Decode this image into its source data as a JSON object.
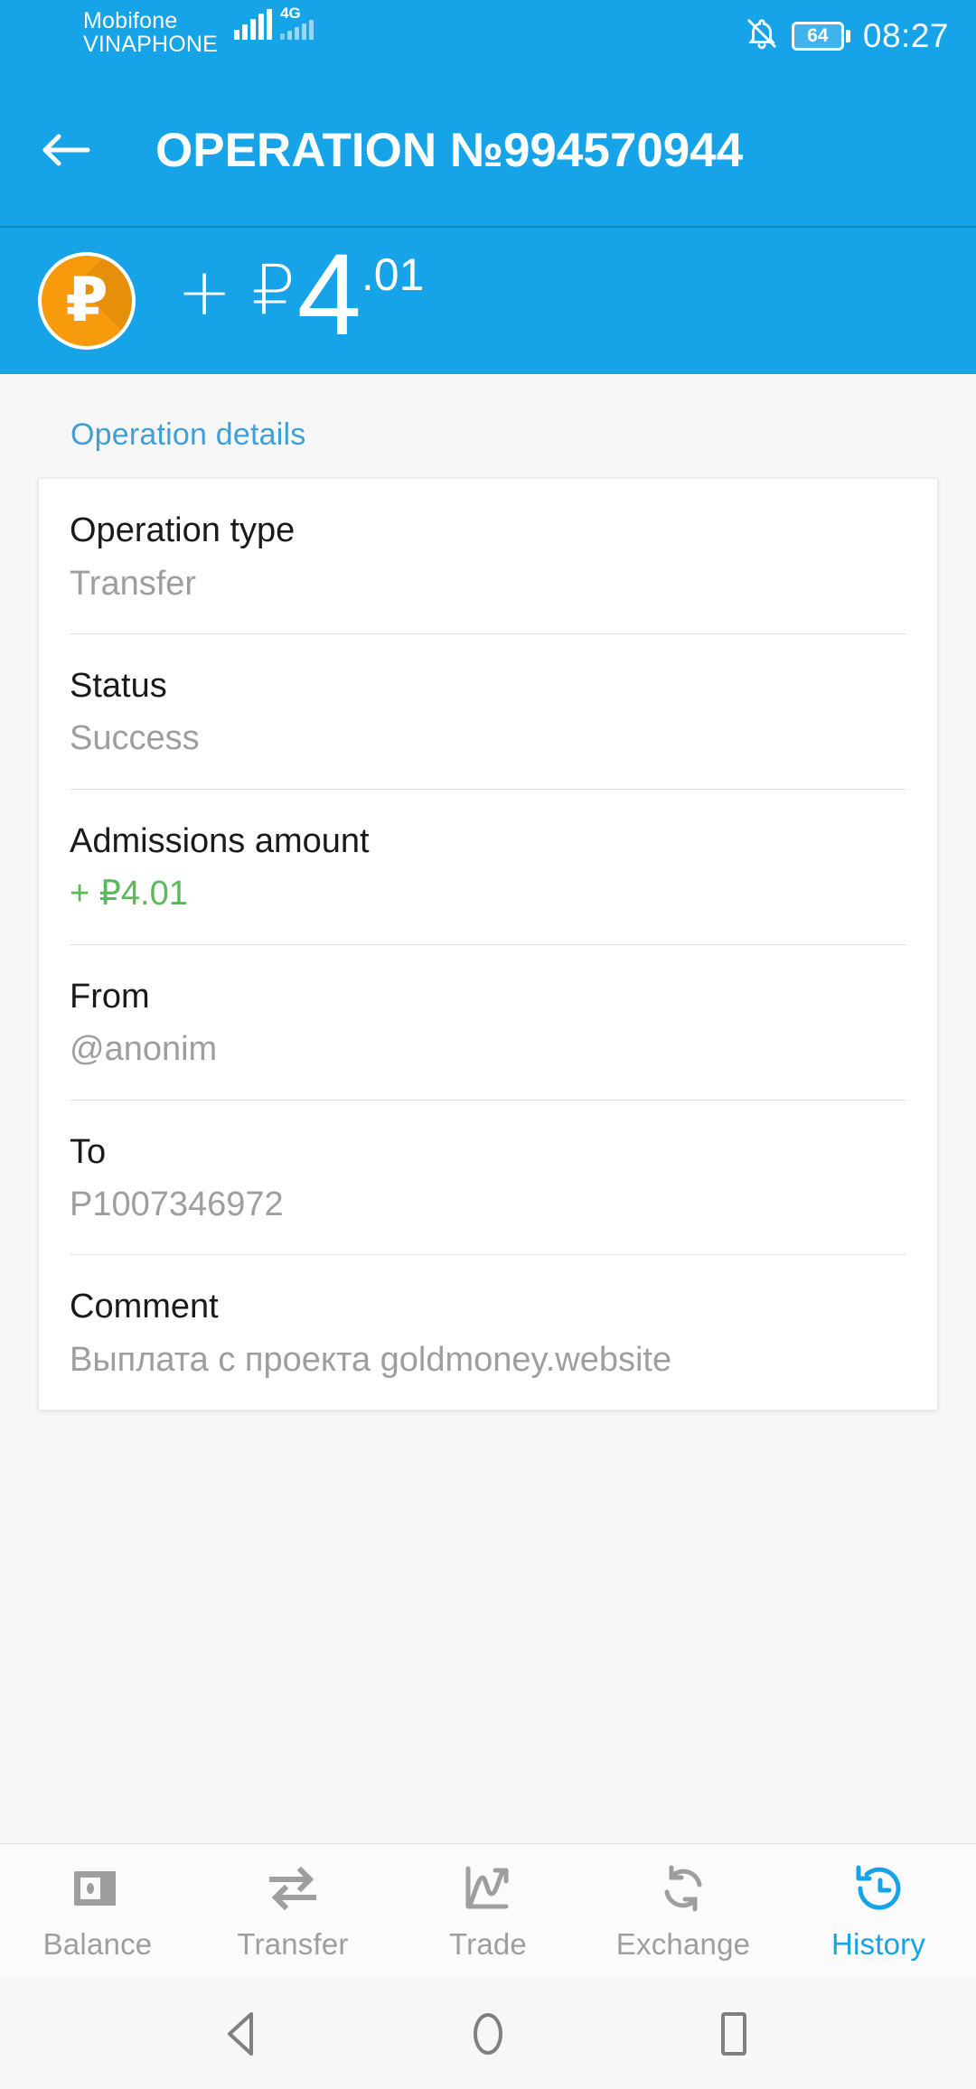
{
  "statusbar": {
    "carrier_primary": "Mobifone",
    "carrier_secondary": "VINAPHONE",
    "network_type": "4G",
    "battery_level": "64",
    "time": "08:27",
    "icons": [
      "signal-bars-icon",
      "network-4g-icon",
      "silent-bell-icon",
      "battery-icon"
    ]
  },
  "appbar": {
    "back_icon": "arrow-left-icon",
    "title": "OPERATION №994570944"
  },
  "hero": {
    "coin_icon": "ruble-coin-icon",
    "coin_symbol": "₽",
    "sign": "+",
    "currency": "₽",
    "integer": "4",
    "decimal": ".01",
    "accent_color": "#16a3e8",
    "coin_color": "#f79a0c"
  },
  "content": {
    "section_title": "Operation details",
    "rows": [
      {
        "label": "Operation type",
        "value": "Transfer",
        "positive": false
      },
      {
        "label": "Status",
        "value": "Success",
        "positive": false
      },
      {
        "label": "Admissions amount",
        "value": "+ ₽4.01",
        "positive": true
      },
      {
        "label": "From",
        "value": "@anonim",
        "positive": false
      },
      {
        "label": "To",
        "value": "P1007346972",
        "positive": false
      },
      {
        "label": "Comment",
        "value": "Выплата с проекта goldmoney.website",
        "positive": false
      }
    ],
    "positive_color": "#5cb85c",
    "link_color": "#3f9fd6"
  },
  "tabbar": {
    "active_color": "#16a3e8",
    "inactive_color": "#9e9e9e",
    "items": [
      {
        "label": "Balance",
        "icon": "wallet-icon",
        "active": false
      },
      {
        "label": "Transfer",
        "icon": "arrows-exchange-icon",
        "active": false
      },
      {
        "label": "Trade",
        "icon": "chart-up-icon",
        "active": false
      },
      {
        "label": "Exchange",
        "icon": "refresh-icon",
        "active": false
      },
      {
        "label": "History",
        "icon": "clock-back-icon",
        "active": true
      }
    ]
  },
  "androidnav": {
    "buttons": [
      {
        "icon": "nav-back-triangle-icon"
      },
      {
        "icon": "nav-home-circle-icon"
      },
      {
        "icon": "nav-recents-square-icon"
      }
    ]
  }
}
